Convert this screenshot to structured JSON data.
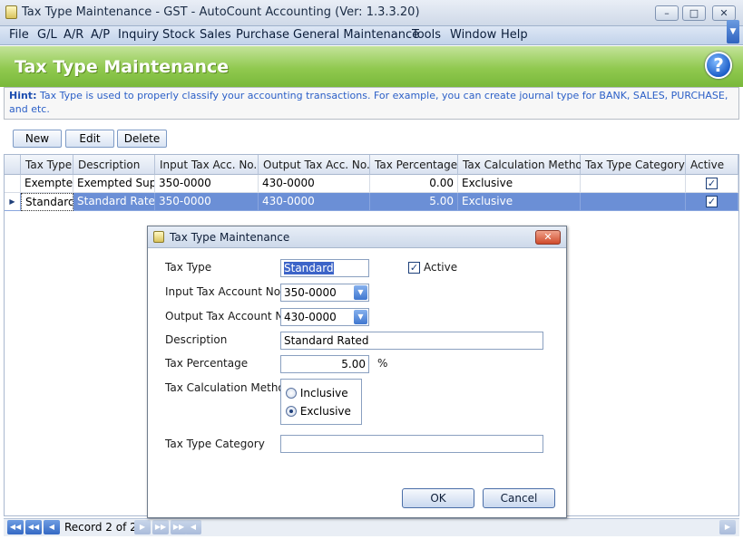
{
  "window": {
    "title": "Tax Type Maintenance - GST - AutoCount Accounting (Ver: 1.3.3.20)"
  },
  "menu": [
    "File",
    "G/L",
    "A/R",
    "A/P",
    "Inquiry",
    "Stock",
    "Sales",
    "Purchase",
    "General Maintenance",
    "Tools",
    "Window",
    "Help"
  ],
  "header": {
    "title": "Tax Type Maintenance"
  },
  "hint": {
    "label": "Hint:",
    "text": "Tax Type is used to properly classify your accounting transactions. For example, you can create journal type for BANK, SALES, PURCHASE, and etc."
  },
  "toolbar": {
    "new_label": "New",
    "edit_label": "Edit",
    "delete_label": "Delete"
  },
  "grid": {
    "columns": [
      "Tax Type",
      "Description",
      "Input Tax Acc. No.",
      "Output Tax Acc. No.",
      "Tax Percentage",
      "Tax Calculation Method",
      "Tax Type Category",
      "Active"
    ],
    "rows": [
      {
        "tax_type": "Exempted",
        "description": "Exempted Sup…",
        "input_acc": "350-0000",
        "output_acc": "430-0000",
        "percentage": "0.00",
        "method": "Exclusive",
        "category": "",
        "active": true
      },
      {
        "tax_type": "Standard",
        "description": "Standard Rated",
        "input_acc": "350-0000",
        "output_acc": "430-0000",
        "percentage": "5.00",
        "method": "Exclusive",
        "category": "",
        "active": true
      }
    ],
    "selected_row": 1
  },
  "status": {
    "record_text": "Record 2 of 2"
  },
  "dialog": {
    "title": "Tax Type Maintenance",
    "tax_type_label": "Tax Type",
    "tax_type_value": "Standard",
    "active_label": "Active",
    "active_checked": true,
    "input_acc_label": "Input Tax Account No",
    "input_acc_value": "350-0000",
    "output_acc_label": "Output Tax Account No",
    "output_acc_value": "430-0000",
    "description_label": "Description",
    "description_value": "Standard Rated",
    "percentage_label": "Tax Percentage",
    "percentage_value": "5.00",
    "percent_sign": "%",
    "method_label": "Tax Calculation Method",
    "method_options": [
      "Inclusive",
      "Exclusive"
    ],
    "method_selected": "Exclusive",
    "category_label": "Tax Type Category",
    "category_value": "",
    "ok_label": "OK",
    "cancel_label": "Cancel"
  },
  "colors": {
    "header_green": "#8cc64a",
    "selection_blue": "#6b8fd6",
    "hint_text": "#2b5fc7"
  }
}
